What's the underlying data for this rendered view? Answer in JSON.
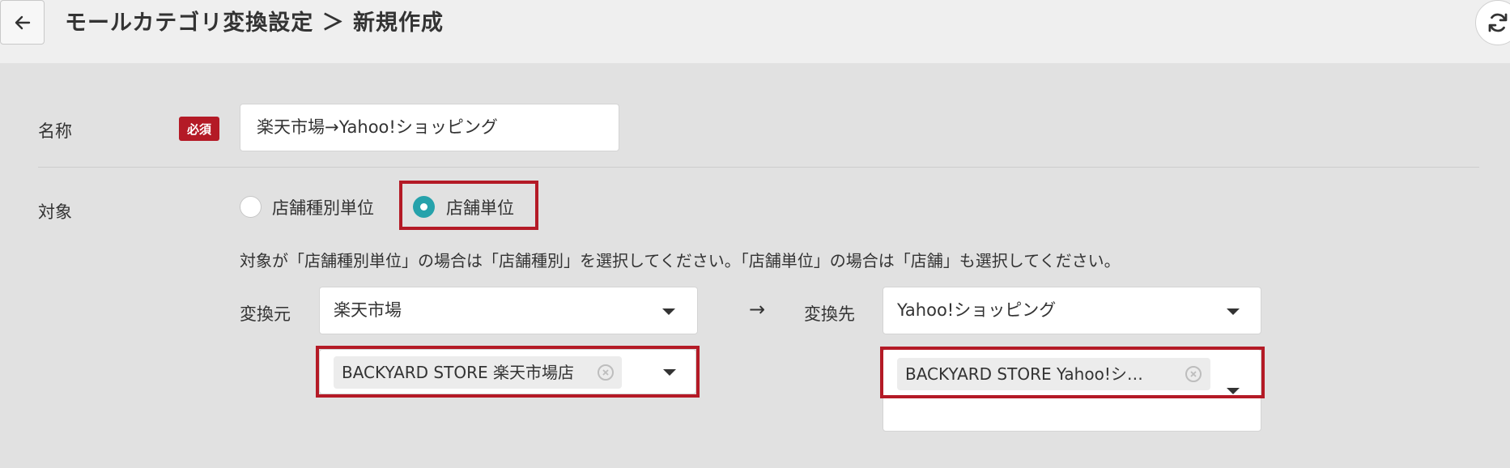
{
  "header": {
    "title": "モールカテゴリ変換設定 ＞ 新規作成",
    "back_icon": "arrow-left-icon",
    "refresh_icon": "refresh-icon"
  },
  "form": {
    "name": {
      "label": "名称",
      "required_badge": "必須",
      "value": "楽天市場→Yahoo!ショッピング"
    },
    "target": {
      "label": "対象",
      "options": [
        "店舗種別単位",
        "店舗単位"
      ],
      "selected": "店舗単位",
      "help": "対象が「店舗種別単位」の場合は「店舗種別」を選択してください。「店舗単位」の場合は「店舗」も選択してください。"
    },
    "source": {
      "label": "変換元",
      "mall": "楽天市場",
      "store_chip": "BACKYARD STORE 楽天市場店"
    },
    "arrow": "→",
    "destination": {
      "label": "変換先",
      "mall": "Yahoo!ショッピング",
      "store_chip": "BACKYARD STORE Yahoo!シ…"
    }
  },
  "colors": {
    "accent": "#26a2ab",
    "required": "#b41a26",
    "highlight": "#b41a26",
    "background": "#e1e1e1",
    "header": "#efefef"
  }
}
